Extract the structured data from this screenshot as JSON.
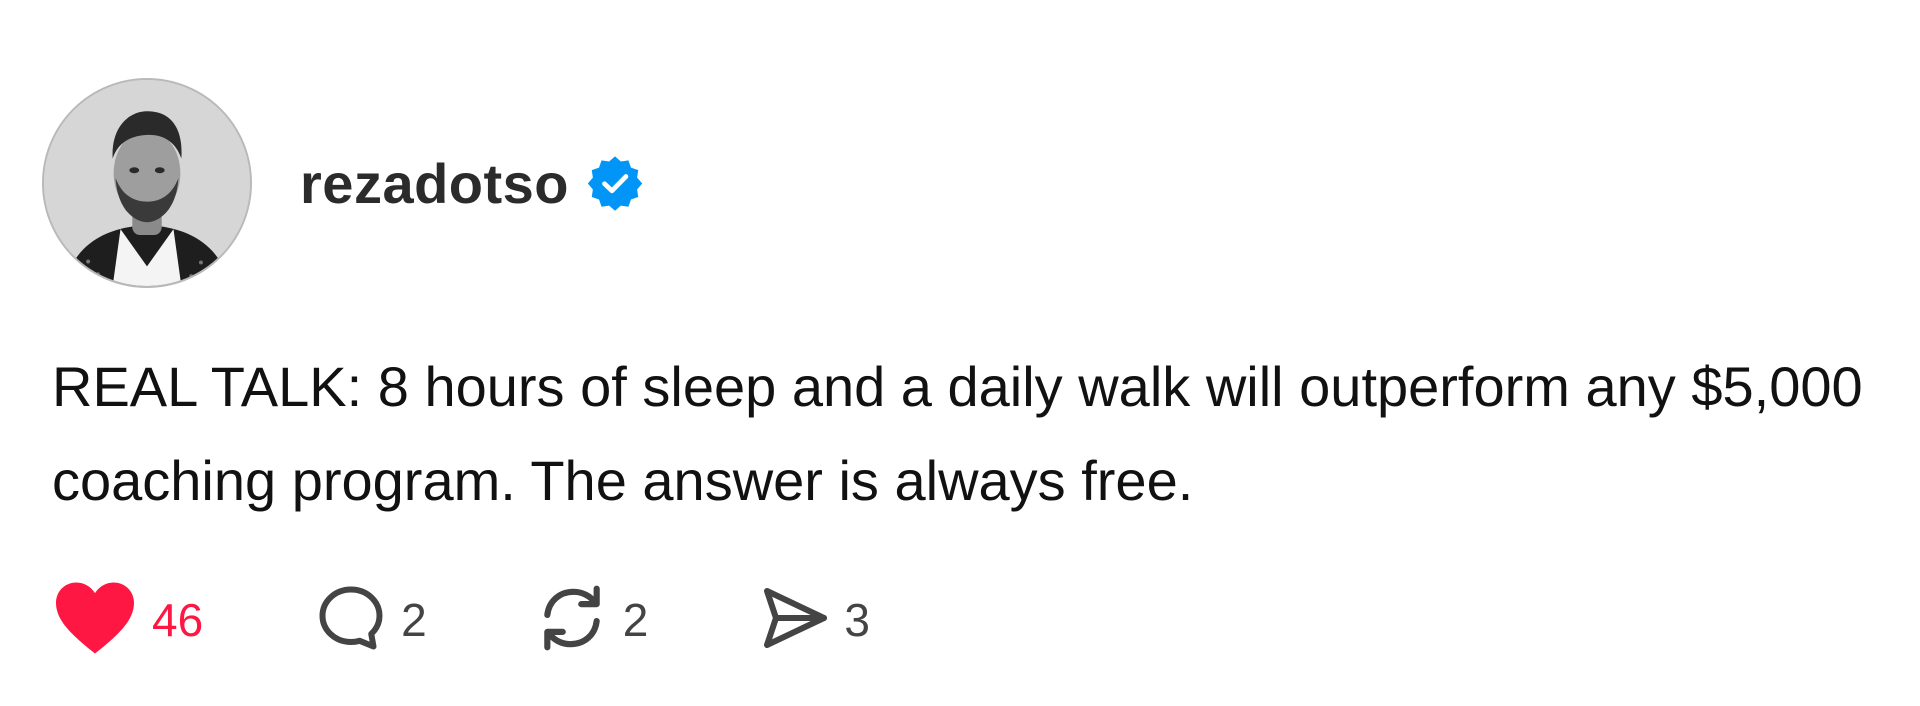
{
  "post": {
    "username": "rezadotso",
    "verified": true,
    "text": "REAL TALK: 8 hours of sleep and a daily walk will outperform any $5,000 coaching program. The answer is always free.",
    "actions": {
      "like": {
        "icon": "heart-icon",
        "count": "46",
        "liked": true
      },
      "comment": {
        "icon": "comment-icon",
        "count": "2"
      },
      "repost": {
        "icon": "repost-icon",
        "count": "2"
      },
      "share": {
        "icon": "send-icon",
        "count": "3"
      }
    }
  },
  "colors": {
    "like_red": "#ff1744",
    "verified_blue": "#0095f6",
    "text": "#111111",
    "muted": "#444444"
  }
}
